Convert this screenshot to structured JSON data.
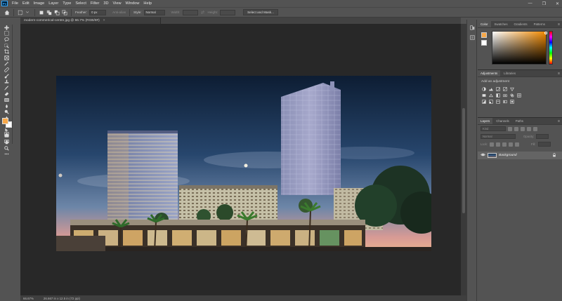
{
  "app": {
    "logo": "Ps"
  },
  "menu": [
    "File",
    "Edit",
    "Image",
    "Layer",
    "Type",
    "Select",
    "Filter",
    "3D",
    "View",
    "Window",
    "Help"
  ],
  "window_controls": [
    "—",
    "❐",
    "✕"
  ],
  "options_bar": {
    "feather_label": "Feather:",
    "feather_value": "0 px",
    "antialias_label": "Anti-alias",
    "style_label": "Style:",
    "style_value": "Normal",
    "width_label": "Width:",
    "height_label": "Height:",
    "select_mask_button": "Select and Mask..."
  },
  "document": {
    "tab_title": "modern-commerical-centre.jpg @ 66.7% (RGB/8#)",
    "close_glyph": "×",
    "zoom": "66.67%",
    "doc_info": "26.667 in x 12.5 in (72 ppi)"
  },
  "colors": {
    "foreground": "#f7a849",
    "background": "#ffffff"
  },
  "color_panel": {
    "tabs": [
      "Color",
      "Swatches",
      "Gradients",
      "Patterns"
    ],
    "active_tab": 0
  },
  "adjustments_panel": {
    "tabs": [
      "Adjustments",
      "Libraries"
    ],
    "title": "Add an adjustment"
  },
  "layers_panel": {
    "tabs": [
      "Layers",
      "Channels",
      "Paths"
    ],
    "filter_placeholder": "Kind",
    "blend_mode": "Normal",
    "opacity_label": "Opacity:",
    "lock_label": "Lock:",
    "fill_label": "Fill:",
    "layers": [
      {
        "name": "Background",
        "locked": true,
        "visible": true
      }
    ]
  }
}
